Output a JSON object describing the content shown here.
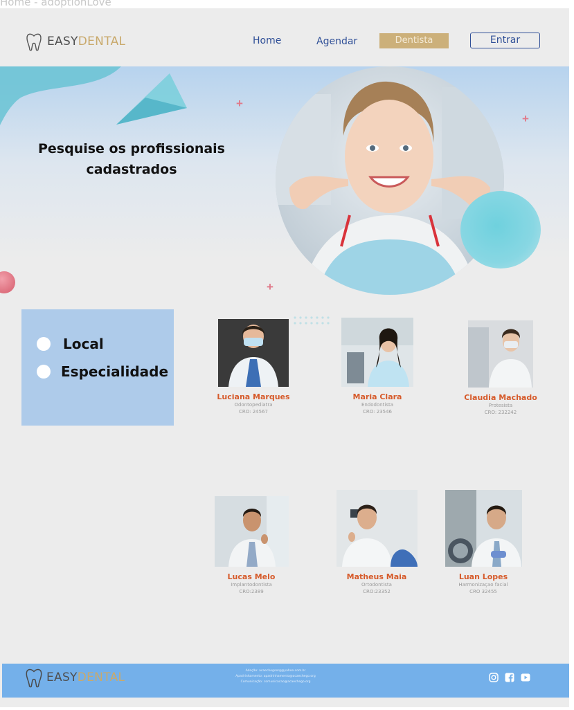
{
  "browser": {
    "tab_title": "Home - adoptionLove"
  },
  "header": {
    "logo_text_primary": "EASY",
    "logo_text_accent": "DENTAL",
    "nav": [
      {
        "label": "Home"
      },
      {
        "label": "Agendar"
      }
    ],
    "dentista_label": "Dentista",
    "entrar_label": "Entrar"
  },
  "hero": {
    "title_line1": "Pesquise os profissionais",
    "title_line2": "cadastrados"
  },
  "filter": {
    "options": [
      {
        "label": "Local"
      },
      {
        "label": "Especialidade"
      }
    ]
  },
  "dentists": [
    {
      "name": "Luciana Marques",
      "specialty": "Odontopediatra",
      "cro": "CRO: 24567"
    },
    {
      "name": "Maria Clara",
      "specialty": "Endodontista",
      "cro": "CRO: 23546"
    },
    {
      "name": "Claudia Machado",
      "specialty": "Protesista",
      "cro": "CRO: 232242"
    },
    {
      "name": "Lucas Melo",
      "specialty": "Implantodontista",
      "cro": "CRO:2389"
    },
    {
      "name": "Matheus Maia",
      "specialty": "Ortodontista",
      "cro": "CRO:23352"
    },
    {
      "name": "Luan Lopes",
      "specialty": "Harmonizaçao facial",
      "cro": "CRO 32455"
    }
  ],
  "footer": {
    "logo_text_primary": "EASY",
    "logo_text_accent": "DENTAL",
    "contacts": [
      "Adoção: acaechegoorg@yahoo.com.br",
      "Apadrinhamento: apadrinhamento@acaechego.org",
      "Comunicação: comunicacao@acaechego.org"
    ],
    "social": [
      "instagram-icon",
      "facebook-icon",
      "youtube-icon"
    ]
  },
  "colors": {
    "accent_gold": "#ccb07a",
    "nav_blue": "#2f4f97",
    "name_orange": "#d65a2a",
    "filter_blue": "#aecbea",
    "footer_blue": "#74b0ea"
  }
}
